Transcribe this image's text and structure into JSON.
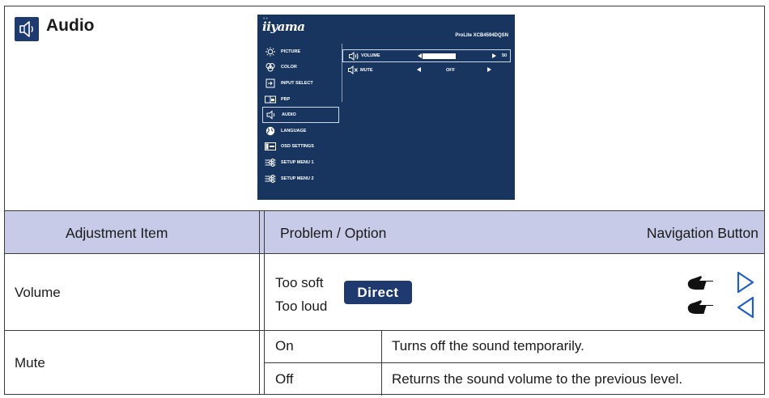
{
  "header": {
    "title": "Audio"
  },
  "osd": {
    "brand": "iiyama",
    "model": "ProLite XCB4594DQSN",
    "menu": [
      "PICTURE",
      "COLOR",
      "INPUT SELECT",
      "PBP",
      "AUDIO",
      "LANGUAGE",
      "OSD SETTINGS",
      "SETUP MENU 1",
      "SETUP MENU 2"
    ],
    "active_menu": "AUDIO",
    "volume_label": "VOLUME",
    "volume_value": "50",
    "volume_level": 0.5,
    "mute_label": "MUTE",
    "mute_value": "OFF"
  },
  "table": {
    "headers": {
      "item": "Adjustment Item",
      "problem": "Problem / Option",
      "nav": "Navigation Button"
    },
    "volume": {
      "item": "Volume",
      "badge": "Direct",
      "soft": "Too soft",
      "loud": "Too loud"
    },
    "mute": {
      "item": "Mute",
      "on": "On",
      "on_desc": "Turns off the sound temporarily.",
      "off": "Off",
      "off_desc": "Returns the sound volume to the previous level."
    }
  },
  "colors": {
    "navy": "#1e3a6e",
    "osd_bg": "#17355e",
    "header_bg": "#c7cbe8",
    "arrow_blue": "#1f5fbf"
  }
}
